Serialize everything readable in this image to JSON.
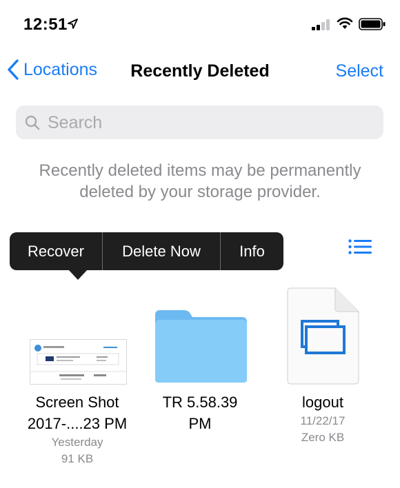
{
  "status_bar": {
    "time": "12:51",
    "icons": [
      "location-arrow-icon",
      "cellular-signal-icon",
      "wifi-icon",
      "battery-icon"
    ]
  },
  "nav": {
    "back_label": "Locations",
    "title": "Recently Deleted",
    "select_label": "Select"
  },
  "search": {
    "placeholder": "Search",
    "value": ""
  },
  "info_text": {
    "line1": "Recently deleted items may be permanently",
    "line2": "deleted by your storage provider."
  },
  "context_menu": {
    "items": [
      "Recover",
      "Delete Now",
      "Info"
    ]
  },
  "files": [
    {
      "name_line1": "Screen Shot",
      "name_line2": "2017-....23 PM",
      "meta1": "Yesterday",
      "meta2": "91 KB"
    },
    {
      "name_line1": "TR 5.58.39",
      "name_line2": "PM",
      "meta1": "",
      "meta2": ""
    },
    {
      "name_line1": "logout",
      "name_line2": "",
      "meta1": "11/22/17",
      "meta2": "Zero KB"
    }
  ],
  "colors": {
    "accent": "#1a7cf6",
    "menu_bg": "#1f1f1f",
    "folder": "#78c3f5",
    "secondary_text": "#8a8a8f"
  }
}
